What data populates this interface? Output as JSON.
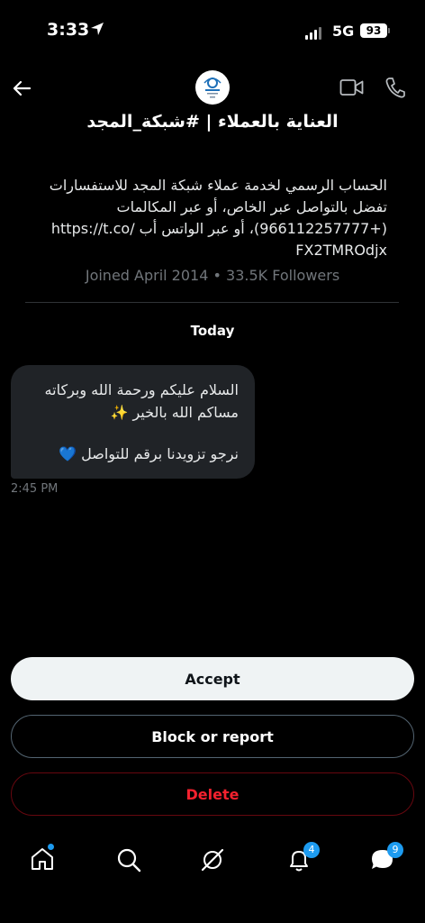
{
  "status_bar": {
    "time": "3:33",
    "network": "5G",
    "battery": "93"
  },
  "header": {
    "title": "العناية بالعملاء | #شبكة_المجد"
  },
  "profile": {
    "bio_lines": [
      "الحساب الرسمي لخدمة عملاء شبكة المجد للاستفسارات",
      "تفضل بالتواصل عبر الخاص، أو عبر المكالمات",
      "(+966112257777)، أو عبر الواتس أب /https://t.co",
      "FX2TMROdjx"
    ],
    "joined": "Joined April 2014 • 33.5K Followers"
  },
  "chat": {
    "date_label": "Today",
    "message": {
      "line1": "السلام عليكم ورحمة الله وبركاته",
      "line2": "مساكم الله بالخير ✨",
      "line3": "نرجو تزويدنا برقم للتواصل 💙",
      "time": "2:45 PM"
    }
  },
  "actions": {
    "accept": "Accept",
    "block": "Block or report",
    "delete": "Delete"
  },
  "tabbar": {
    "notifications_badge": "4",
    "messages_badge": "9"
  },
  "colors": {
    "accent": "#1d9bf0",
    "danger": "#f4212e",
    "bubble": "#202327"
  }
}
